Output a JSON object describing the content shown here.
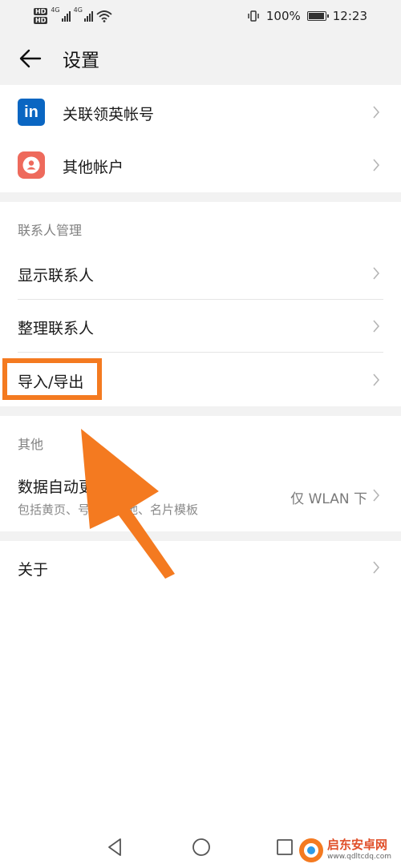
{
  "status_bar": {
    "hd_badges": [
      "HD",
      "HD"
    ],
    "network_labels": [
      "4G",
      "4G"
    ],
    "battery_percent": "100%",
    "battery_level": 1.0,
    "time": "12:23"
  },
  "header": {
    "title": "设置"
  },
  "accounts": {
    "items": [
      {
        "label": "关联领英帐号",
        "icon": "linkedin-icon",
        "icon_text": "in",
        "icon_color": "#0a66c2"
      },
      {
        "label": "其他帐户",
        "icon": "account-icon",
        "icon_color": "#ee6a5c"
      }
    ]
  },
  "contacts_section": {
    "title": "联系人管理",
    "items": [
      {
        "label": "显示联系人"
      },
      {
        "label": "整理联系人"
      },
      {
        "label": "导入/导出"
      }
    ]
  },
  "other_section": {
    "title": "其他",
    "data_update": {
      "label": "数据自动更",
      "subtitle": "包括黄页、号",
      "subtitle_tail": "属地、名片模板",
      "value": "仅 WLAN 下"
    }
  },
  "about": {
    "label": "关于"
  },
  "annotation": {
    "highlight_color": "#f47a20",
    "arrow_color": "#f47a20"
  },
  "watermark": {
    "brand": "启东安卓网",
    "url": "www.qdltcdq.com"
  }
}
